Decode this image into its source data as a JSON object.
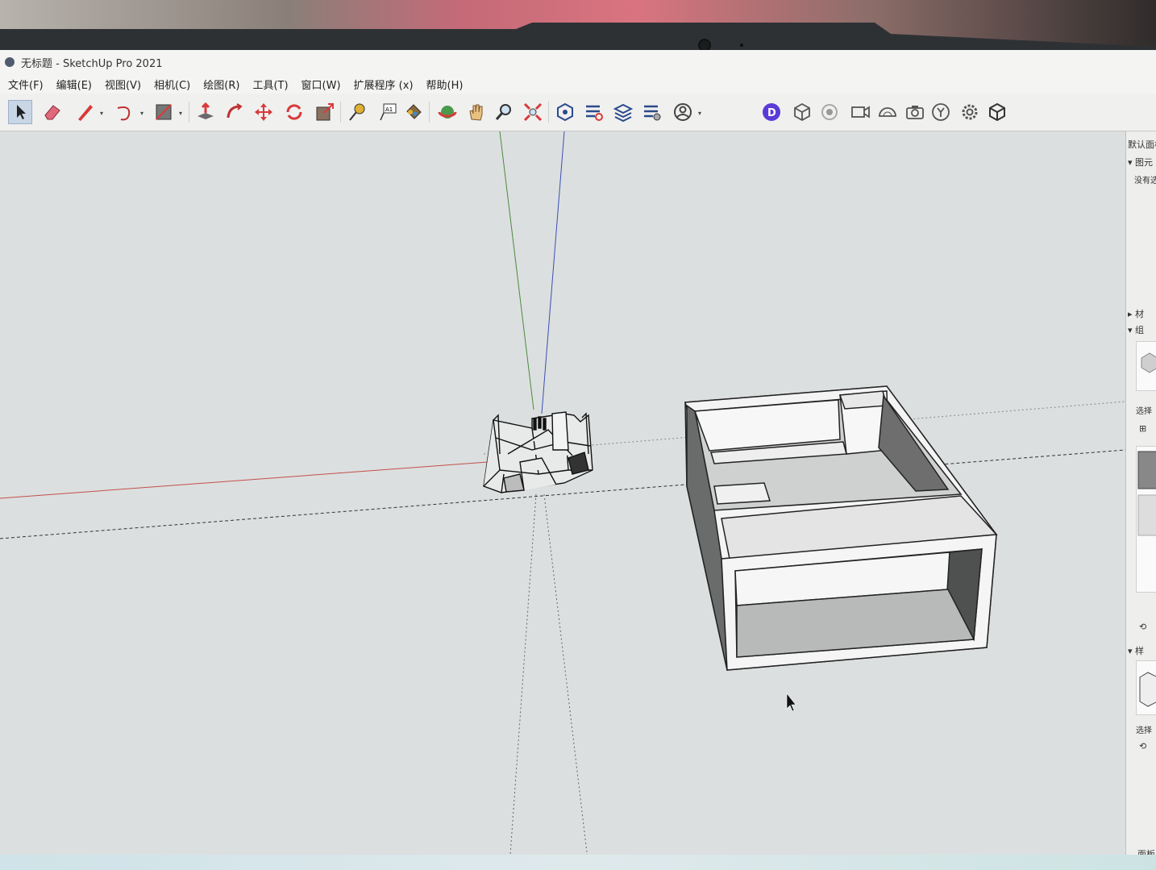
{
  "window": {
    "title": "无标题 - SketchUp Pro 2021"
  },
  "menu": [
    "文件(F)",
    "编辑(E)",
    "视图(V)",
    "相机(C)",
    "绘图(R)",
    "工具(T)",
    "窗口(W)",
    "扩展程序 (x)",
    "帮助(H)"
  ],
  "toolbar": {
    "tools": [
      "select-icon",
      "eraser-icon",
      "pencil-line-icon",
      "arc-icon",
      "rectangle-icon",
      "push-pull-icon",
      "follow-me-icon",
      "move-icon",
      "rotate-icon",
      "scale-icon",
      "tape-measure-icon",
      "text-icon",
      "paint-bucket-icon",
      "orbit-icon",
      "pan-icon",
      "zoom-icon",
      "zoom-extents-icon",
      "warehouse-icon",
      "extension-warehouse-icon",
      "layout-icon",
      "extension-manager-icon",
      "profile-icon"
    ],
    "right_tools": [
      "d5-render-icon",
      "component-box-icon",
      "rotate-target-icon",
      "video-camera-icon",
      "dome-icon",
      "camera-icon",
      "y-axis-icon",
      "settings-gear-icon",
      "export-box-icon"
    ],
    "d5_badge": "D",
    "text_tool_label": "A1"
  },
  "tray": {
    "header": "默认面板",
    "section_entity": "图元",
    "entity_empty": "没有选",
    "section_materials": "材",
    "section_components": "组",
    "select_label": "选择",
    "section_styles": "样",
    "select_label_2": "选择",
    "footer": "面板"
  },
  "colors": {
    "accent_selected": "#c9d6e6",
    "axis_red": "#c0504d",
    "axis_green": "#4a8a3f",
    "axis_blue": "#3b4fb8",
    "viewport_bg": "#dcdfdf"
  }
}
